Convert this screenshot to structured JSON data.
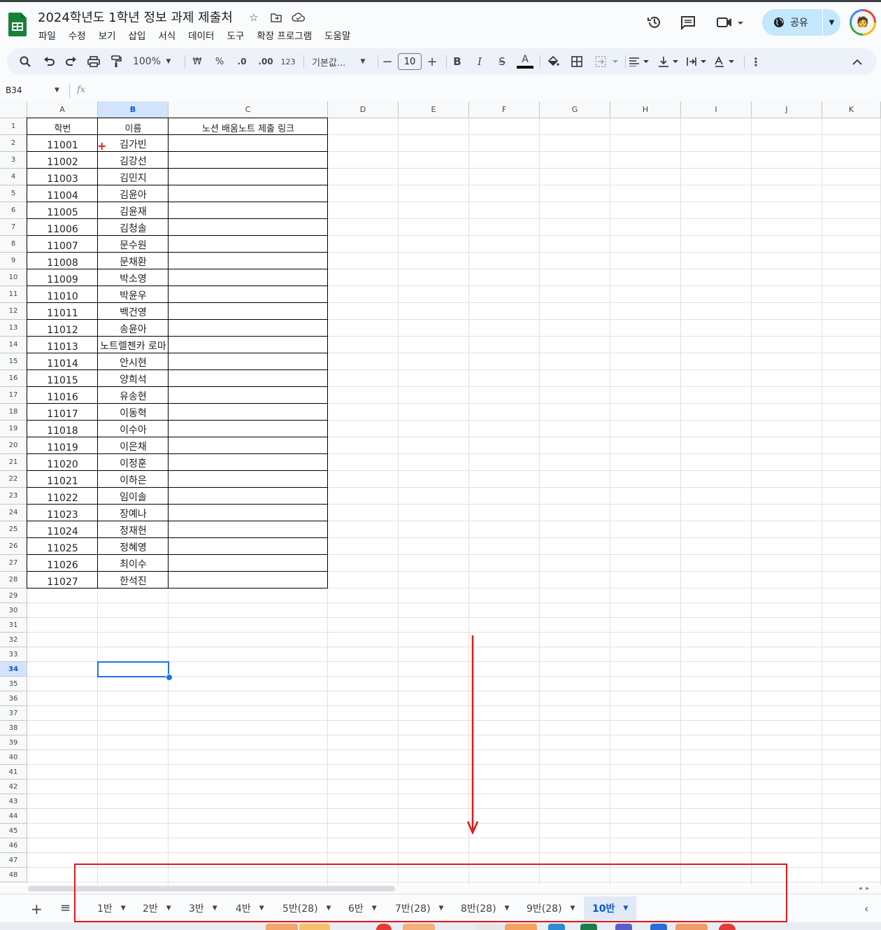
{
  "header": {
    "title": "2024학년도 1학년 정보 과제 제출처",
    "menu": [
      "파일",
      "수정",
      "보기",
      "삽입",
      "서식",
      "데이터",
      "도구",
      "확장 프로그램",
      "도움말"
    ],
    "share_label": "공유"
  },
  "toolbar": {
    "zoom": "100%",
    "currency": "₩",
    "percent": "%",
    "dec_decrease": ".0",
    "dec_increase": ".00",
    "number_format": "123",
    "font": "기본값...",
    "font_size": "10",
    "bold": "B",
    "italic": "I",
    "strike": "S",
    "text_color": "A"
  },
  "formula_bar": {
    "name_box": "B34",
    "fx": "fx"
  },
  "grid": {
    "columns": [
      "A",
      "B",
      "C",
      "D",
      "E",
      "F",
      "G",
      "H",
      "I",
      "J",
      "K"
    ],
    "selected_column": "B",
    "selected_row": "34",
    "row_count": 48,
    "headers": [
      "학번",
      "이름",
      "노션 배움노트 제출 링크"
    ],
    "rows": [
      [
        "11001",
        "김가빈"
      ],
      [
        "11002",
        "김강선"
      ],
      [
        "11003",
        "김민지"
      ],
      [
        "11004",
        "김윤아"
      ],
      [
        "11005",
        "김윤재"
      ],
      [
        "11006",
        "김청솔"
      ],
      [
        "11007",
        "문수원"
      ],
      [
        "11008",
        "문채환"
      ],
      [
        "11009",
        "박소영"
      ],
      [
        "11010",
        "박윤우"
      ],
      [
        "11011",
        "백건영"
      ],
      [
        "11012",
        "송윤아"
      ],
      [
        "11013",
        "노트렐첸카 로마"
      ],
      [
        "11014",
        "안시현"
      ],
      [
        "11015",
        "양희석"
      ],
      [
        "11016",
        "유송현"
      ],
      [
        "11017",
        "이동혁"
      ],
      [
        "11018",
        "이수아"
      ],
      [
        "11019",
        "이은채"
      ],
      [
        "11020",
        "이정훈"
      ],
      [
        "11021",
        "이하은"
      ],
      [
        "11022",
        "임이솔"
      ],
      [
        "11023",
        "장예나"
      ],
      [
        "11024",
        "정재헌"
      ],
      [
        "11025",
        "정혜영"
      ],
      [
        "11026",
        "최이수"
      ],
      [
        "11027",
        "한석진"
      ]
    ]
  },
  "sheet_tabs": [
    "1반",
    "2반",
    "3반",
    "4반",
    "5반(28)",
    "6반",
    "7반(28)",
    "8반(28)",
    "9반(28)",
    "10반"
  ],
  "active_tab": "10반",
  "colors": {
    "accent": "#0b57d0",
    "share_bg": "#c2e7ff",
    "annotation_red": "#e01818",
    "sheets_green": "#188038"
  }
}
